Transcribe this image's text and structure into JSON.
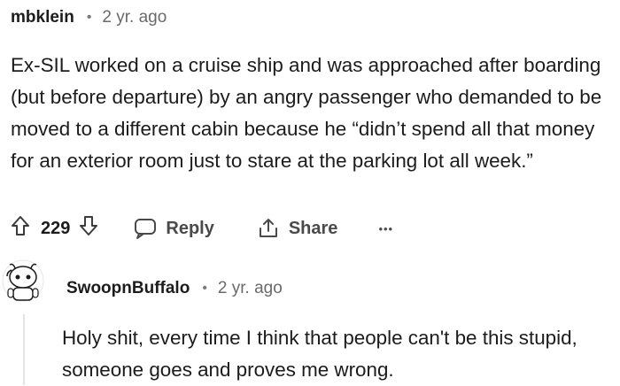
{
  "comment": {
    "username": "mbklein",
    "separator": "•",
    "time": "2 yr. ago",
    "body": "Ex-SIL worked on a cruise ship and was approached after boarding (but before departure) by an angry passenger who demanded to be moved to a different cabin because he “didn’t spend all that money for an exterior room just to stare at the parking lot all week.”",
    "votes": "229",
    "reply_label": "Reply",
    "share_label": "Share",
    "more_label": "•••"
  },
  "reply": {
    "username": "SwoopnBuffalo",
    "separator": "•",
    "time": "2 yr. ago",
    "body": "Holy shit, every time I think that people can't be this stupid, someone goes and proves me wrong."
  },
  "icons": {
    "upvote": "upvote-arrow-icon",
    "downvote": "downvote-arrow-icon",
    "reply": "speech-bubble-icon",
    "share": "share-arrow-icon",
    "more": "ellipsis-icon",
    "avatar": "snoo-avatar-icon"
  },
  "colors": {
    "text": "#1c1c1c",
    "muted": "#6a6a6a",
    "thread_line": "#e3e3e3"
  }
}
